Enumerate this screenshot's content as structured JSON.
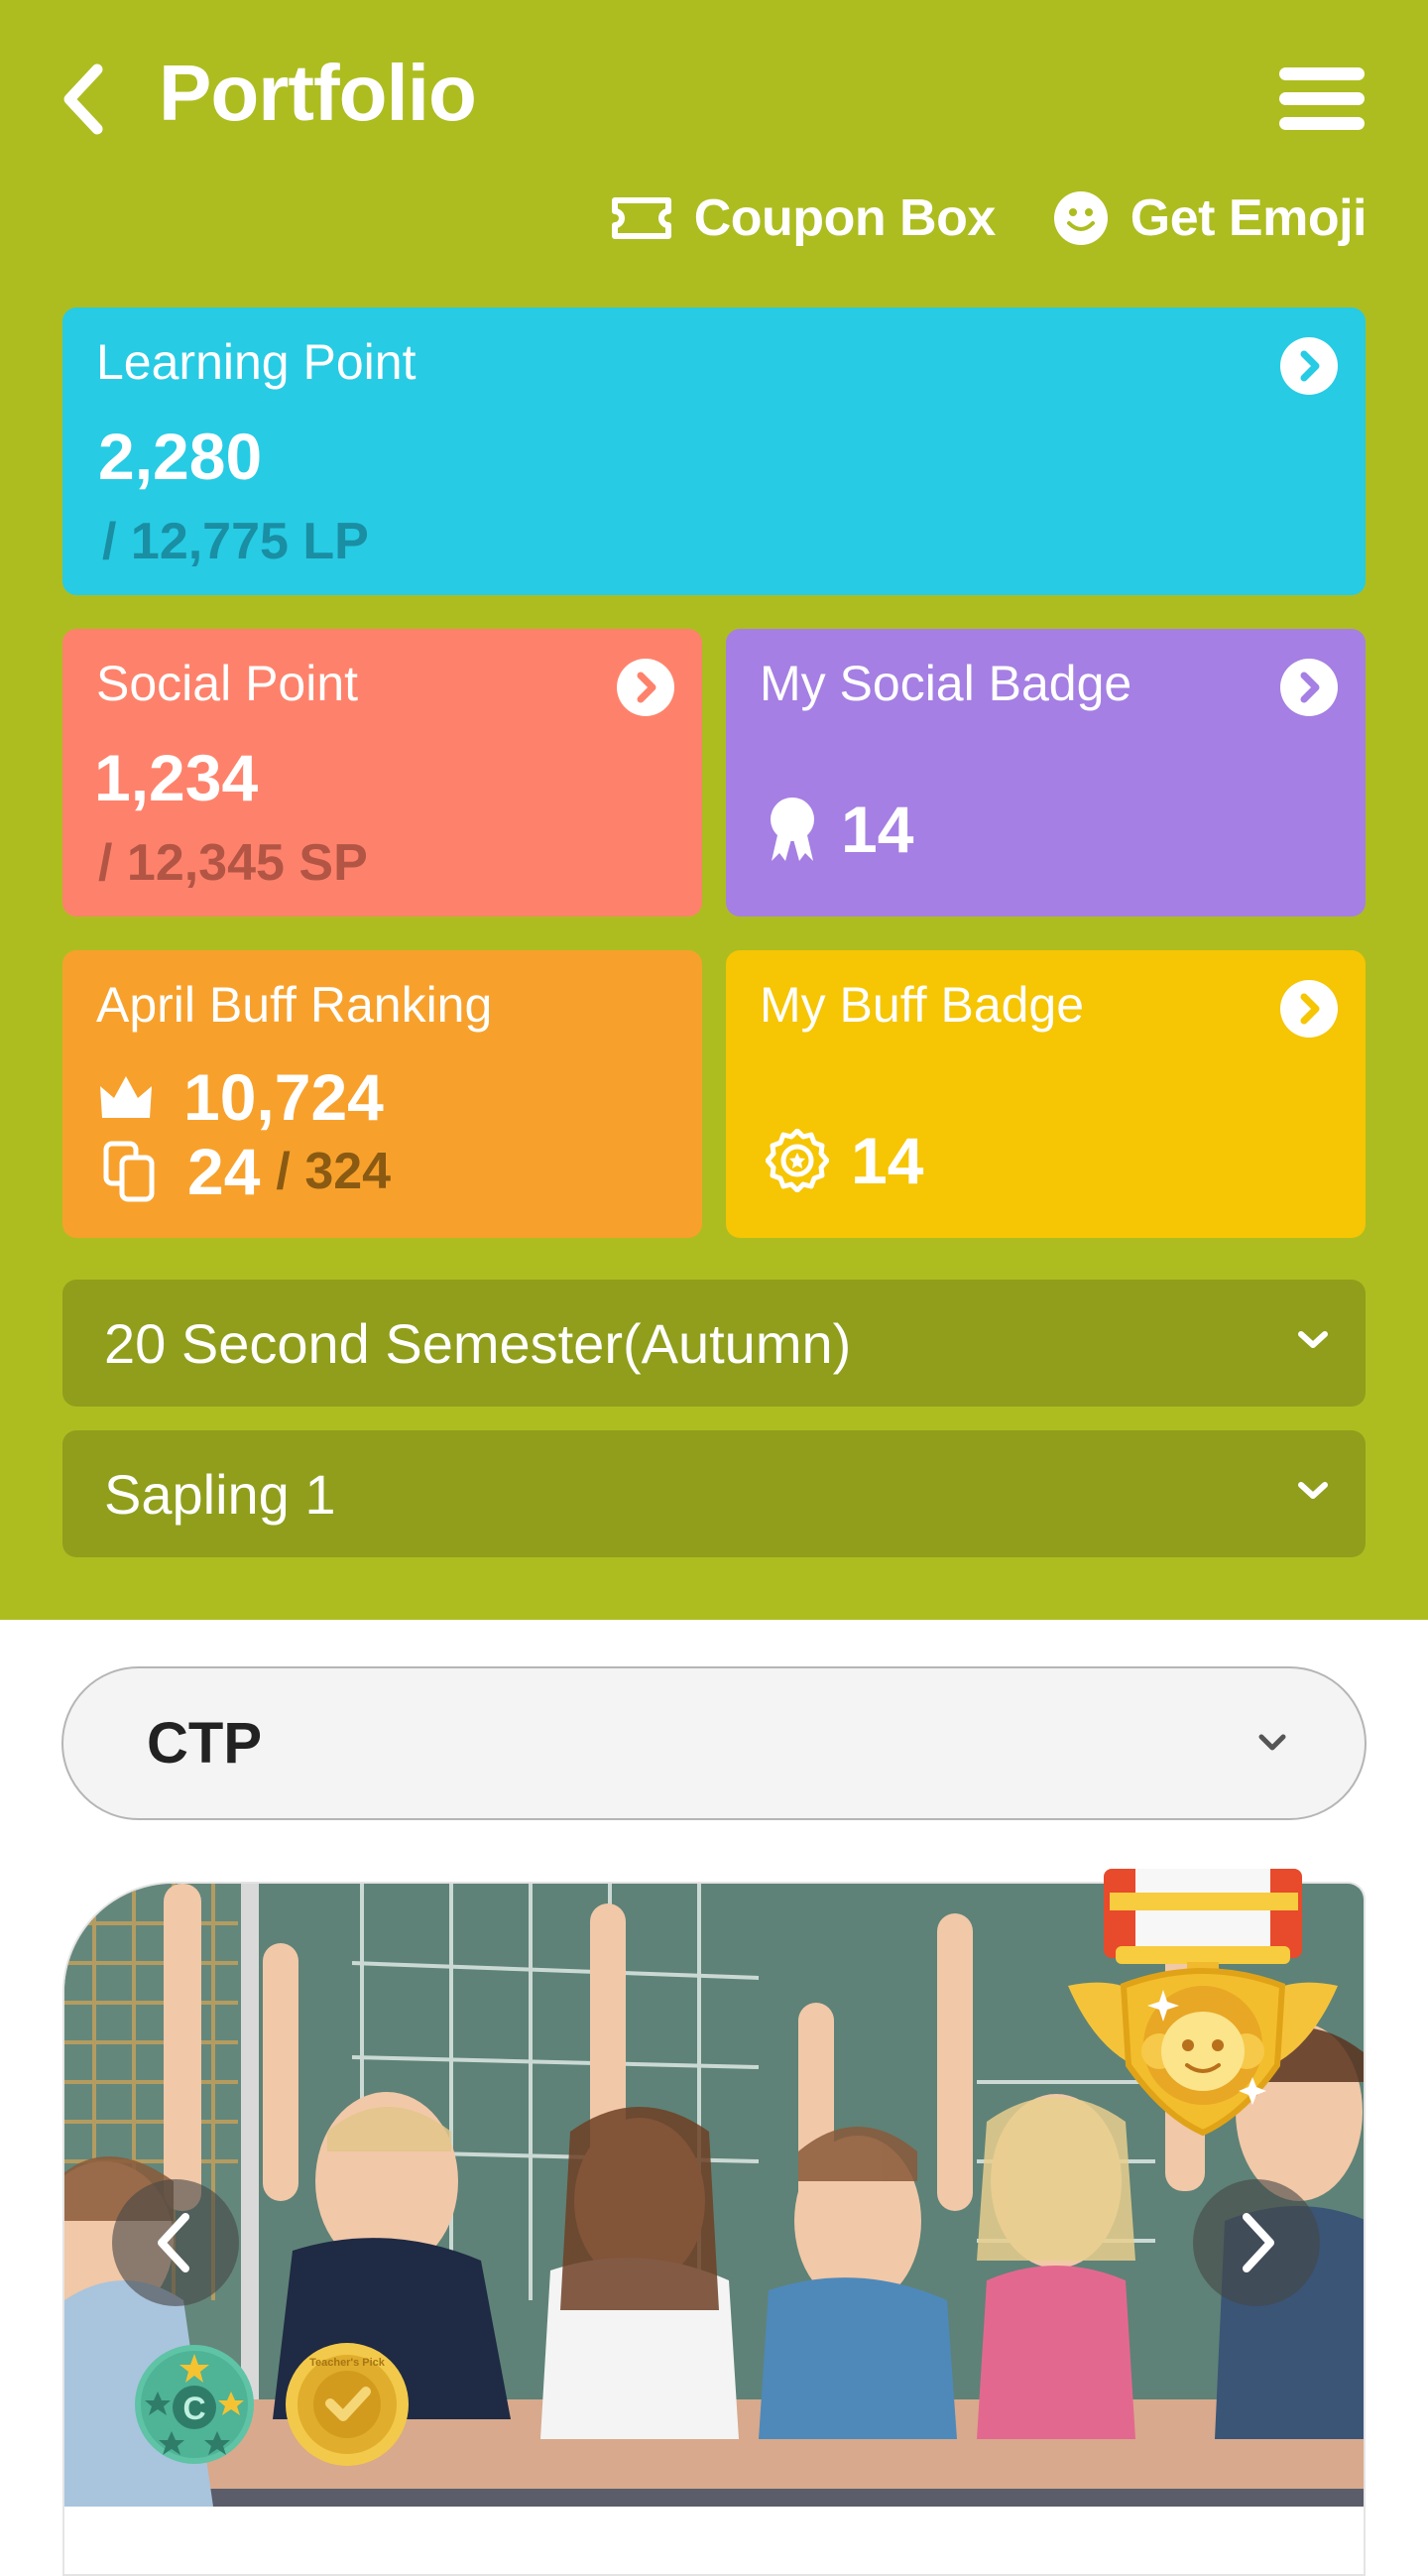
{
  "header": {
    "title": "Portfolio",
    "back_icon": "chevron-left-icon",
    "menu_icon": "hamburger-menu-icon",
    "links": [
      {
        "label": "Coupon Box",
        "icon": "ticket-icon"
      },
      {
        "label": "Get Emoji",
        "icon": "smiley-icon"
      }
    ],
    "background_color": "#adbd20"
  },
  "cards": {
    "learning_point": {
      "label": "Learning Point",
      "value": "2,280",
      "total": "/ 12,775 LP",
      "color": "#27cbe4"
    },
    "social_point": {
      "label": "Social Point",
      "value": "1,234",
      "total": "/ 12,345 SP",
      "color": "#fe826b"
    },
    "social_badge": {
      "label": "My Social Badge",
      "count": "14",
      "icon": "ribbon-badge-icon",
      "color": "#a57fe3"
    },
    "buff_ranking": {
      "label": "April Buff Ranking",
      "rank": "10,724",
      "cards": "24",
      "cards_total": "/ 324",
      "rank_icon": "crown-icon",
      "cards_icon": "copy-cards-icon",
      "color": "#f7a12c"
    },
    "buff_badge": {
      "label": "My Buff Badge",
      "count": "14",
      "icon": "star-seal-icon",
      "color": "#f6c503"
    }
  },
  "filters": {
    "semester": "20 Second Semester(Autumn)",
    "level": "Sapling 1",
    "category": "CTP"
  },
  "feed": {
    "image_alt": "Classroom photo of children raising hands",
    "overlay_medal": "gold-monkey-medal-icon",
    "badges": [
      "c-stars-badge-icon",
      "teachers-pick-badge-icon"
    ],
    "teachers_pick_text": "Teacher's Pick",
    "badge_c_letter": "C",
    "prev_icon": "chevron-left-icon",
    "next_icon": "chevron-right-icon"
  }
}
